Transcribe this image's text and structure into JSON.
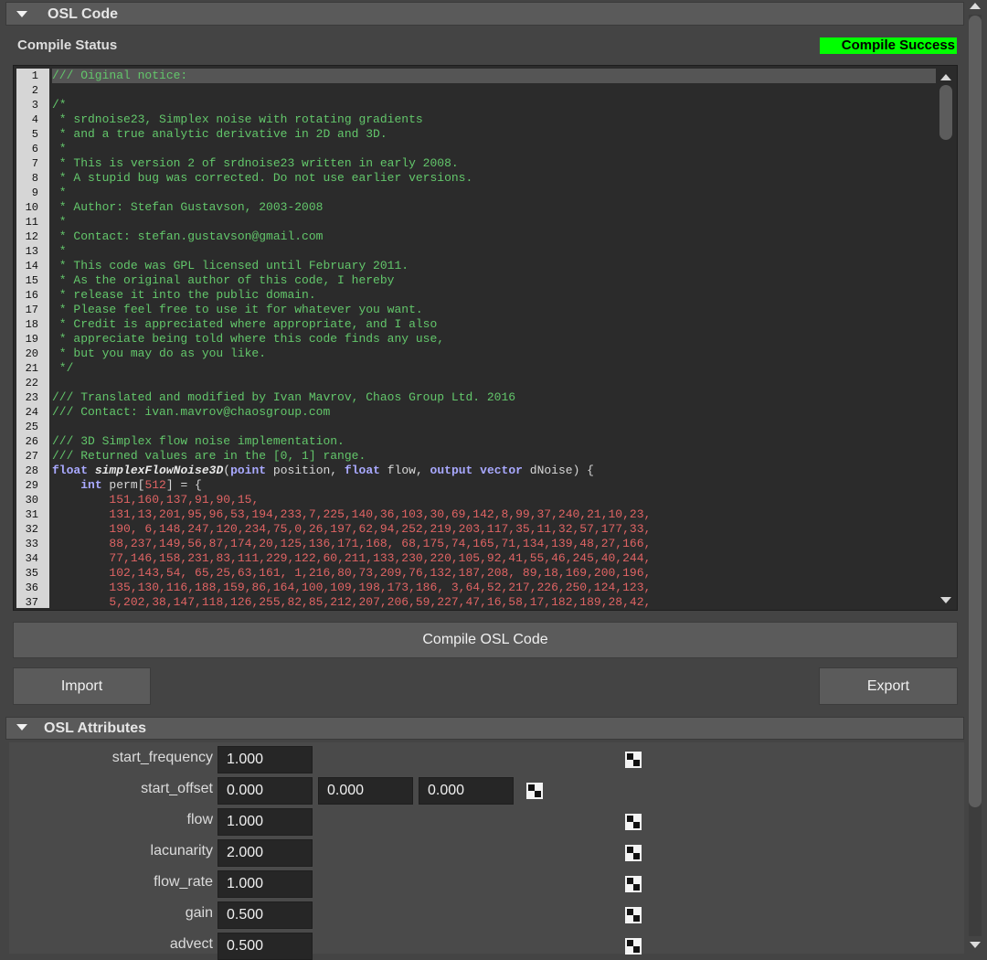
{
  "osl_code_section": {
    "title": "OSL Code"
  },
  "compile_status": {
    "label": "Compile Status",
    "value": "Compile Success",
    "color": "#00ff00"
  },
  "code_lines": [
    [
      [
        "c",
        "/// Oiginal notice:"
      ]
    ],
    [],
    [
      [
        "c",
        "/*"
      ]
    ],
    [
      [
        "c",
        " * srdnoise23, Simplex noise with rotating gradients"
      ]
    ],
    [
      [
        "c",
        " * and a true analytic derivative in 2D and 3D."
      ]
    ],
    [
      [
        "c",
        " *"
      ]
    ],
    [
      [
        "c",
        " * This is version 2 of srdnoise23 written in early 2008."
      ]
    ],
    [
      [
        "c",
        " * A stupid bug was corrected. Do not use earlier versions."
      ]
    ],
    [
      [
        "c",
        " *"
      ]
    ],
    [
      [
        "c",
        " * Author: Stefan Gustavson, 2003-2008"
      ]
    ],
    [
      [
        "c",
        " *"
      ]
    ],
    [
      [
        "c",
        " * Contact: stefan.gustavson@gmail.com"
      ]
    ],
    [
      [
        "c",
        " *"
      ]
    ],
    [
      [
        "c",
        " * This code was GPL licensed until February 2011."
      ]
    ],
    [
      [
        "c",
        " * As the original author of this code, I hereby"
      ]
    ],
    [
      [
        "c",
        " * release it into the public domain."
      ]
    ],
    [
      [
        "c",
        " * Please feel free to use it for whatever you want."
      ]
    ],
    [
      [
        "c",
        " * Credit is appreciated where appropriate, and I also"
      ]
    ],
    [
      [
        "c",
        " * appreciate being told where this code finds any use,"
      ]
    ],
    [
      [
        "c",
        " * but you may do as you like."
      ]
    ],
    [
      [
        "c",
        " */"
      ]
    ],
    [],
    [
      [
        "c",
        "/// Translated and modified by Ivan Mavrov, Chaos Group Ltd. 2016"
      ]
    ],
    [
      [
        "c",
        "/// Contact: ivan.mavrov@chaosgroup.com"
      ]
    ],
    [],
    [
      [
        "c",
        "/// 3D Simplex flow noise implementation."
      ]
    ],
    [
      [
        "c",
        "/// Returned values are in the [0, 1] range."
      ]
    ],
    [
      [
        "k",
        "float"
      ],
      [
        "p",
        " "
      ],
      [
        "f",
        "simplexFlowNoise3D"
      ],
      [
        "p",
        "("
      ],
      [
        "k",
        "point"
      ],
      [
        "p",
        " position, "
      ],
      [
        "k",
        "float"
      ],
      [
        "p",
        " flow, "
      ],
      [
        "k",
        "output vector"
      ],
      [
        "p",
        " dNoise) {"
      ]
    ],
    [
      [
        "p",
        "    "
      ],
      [
        "k",
        "int"
      ],
      [
        "p",
        " perm["
      ],
      [
        "n",
        "512"
      ],
      [
        "p",
        "] = {"
      ]
    ],
    [
      [
        "p",
        "        "
      ],
      [
        "n",
        "151,160,137,91,90,15,"
      ]
    ],
    [
      [
        "p",
        "        "
      ],
      [
        "n",
        "131,13,201,95,96,53,194,233,7,225,140,36,103,30,69,142,8,99,37,240,21,10,23,"
      ]
    ],
    [
      [
        "p",
        "        "
      ],
      [
        "n",
        "190, 6,148,247,120,234,75,0,26,197,62,94,252,219,203,117,35,11,32,57,177,33,"
      ]
    ],
    [
      [
        "p",
        "        "
      ],
      [
        "n",
        "88,237,149,56,87,174,20,125,136,171,168, 68,175,74,165,71,134,139,48,27,166,"
      ]
    ],
    [
      [
        "p",
        "        "
      ],
      [
        "n",
        "77,146,158,231,83,111,229,122,60,211,133,230,220,105,92,41,55,46,245,40,244,"
      ]
    ],
    [
      [
        "p",
        "        "
      ],
      [
        "n",
        "102,143,54, 65,25,63,161, 1,216,80,73,209,76,132,187,208, 89,18,169,200,196,"
      ]
    ],
    [
      [
        "p",
        "        "
      ],
      [
        "n",
        "135,130,116,188,159,86,164,100,109,198,173,186, 3,64,52,217,226,250,124,123,"
      ]
    ],
    [
      [
        "p",
        "        "
      ],
      [
        "n",
        "5,202,38,147,118,126,255,82,85,212,207,206,59,227,47,16,58,17,182,189,28,42,"
      ]
    ]
  ],
  "buttons": {
    "compile": "Compile OSL Code",
    "import": "Import",
    "export": "Export"
  },
  "attributes_section": {
    "title": "OSL Attributes"
  },
  "attributes": [
    {
      "label": "start_frequency",
      "values": [
        "1.000"
      ]
    },
    {
      "label": "start_offset",
      "values": [
        "0.000",
        "0.000",
        "0.000"
      ]
    },
    {
      "label": "flow",
      "values": [
        "1.000"
      ]
    },
    {
      "label": "lacunarity",
      "values": [
        "2.000"
      ]
    },
    {
      "label": "flow_rate",
      "values": [
        "1.000"
      ]
    },
    {
      "label": "gain",
      "values": [
        "0.500"
      ]
    },
    {
      "label": "advect",
      "values": [
        "0.500"
      ]
    }
  ],
  "colors": {
    "comment": "#63c76b",
    "keyword": "#a9a9ff",
    "number": "#e06464",
    "background": "#444444"
  },
  "icons": {
    "collapse": "triangle-down-icon",
    "texture_slot": "checker-icon"
  }
}
